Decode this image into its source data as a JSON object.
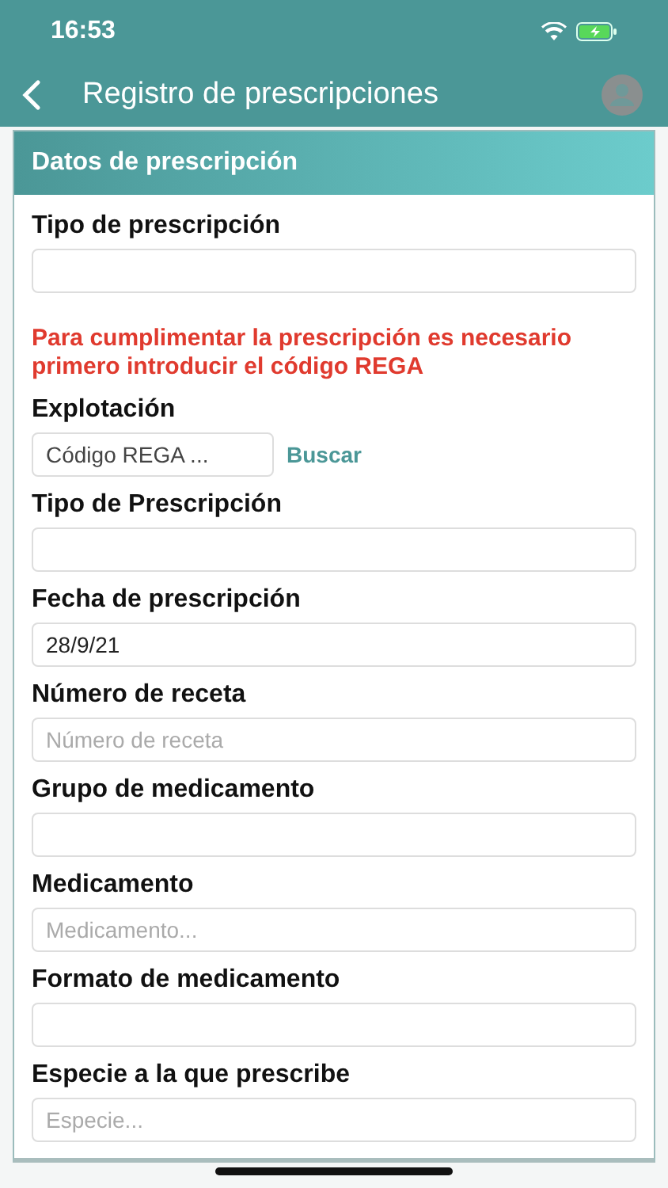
{
  "status_bar": {
    "time": "16:53"
  },
  "header": {
    "title": "Registro de prescripciones"
  },
  "card": {
    "title": "Datos de prescripción",
    "fields": [
      {
        "kind": "input",
        "label": "Tipo de prescripción"
      },
      {
        "kind": "warning",
        "text": "Para cumplimentar la prescripción es necesario primero introducir el código REGA"
      },
      {
        "kind": "search",
        "label": "Explotación",
        "value": "Código REGA ...",
        "action": "Buscar"
      },
      {
        "kind": "input",
        "label": "Tipo de Prescripción"
      },
      {
        "kind": "input",
        "label": "Fecha de prescripción",
        "value": "28/9/21"
      },
      {
        "kind": "input",
        "label": "Número de receta",
        "placeholder": "Número de receta"
      },
      {
        "kind": "input",
        "label": "Grupo de medicamento"
      },
      {
        "kind": "input",
        "label": "Medicamento",
        "placeholder": "Medicamento..."
      },
      {
        "kind": "input",
        "label": "Formato de medicamento"
      },
      {
        "kind": "input",
        "label": "Especie a la que prescribe",
        "placeholder": "Especie..."
      }
    ]
  }
}
